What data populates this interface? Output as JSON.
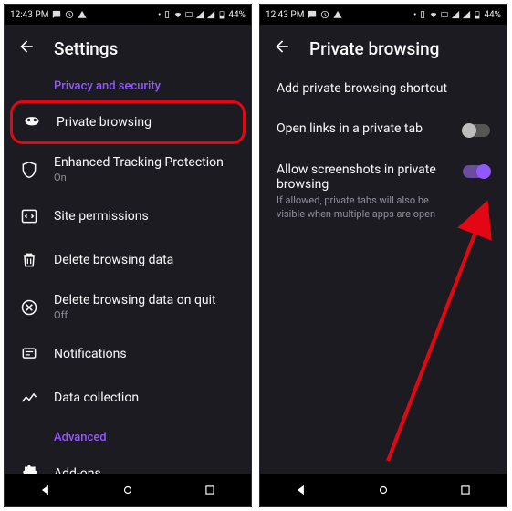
{
  "statusbar": {
    "time": "12:43 PM",
    "battery": "44%"
  },
  "left_screen": {
    "title": "Settings",
    "sections": {
      "privacy_header": "Privacy and security",
      "private_browsing": "Private browsing",
      "etp": {
        "label": "Enhanced Tracking Protection",
        "sub": "On"
      },
      "site_permissions": "Site permissions",
      "delete_data": "Delete browsing data",
      "delete_on_quit": {
        "label": "Delete browsing data on quit",
        "sub": "Off"
      },
      "notifications": "Notifications",
      "data_collection": "Data collection",
      "advanced_header": "Advanced",
      "addons": "Add-ons"
    }
  },
  "right_screen": {
    "title": "Private browsing",
    "rows": {
      "shortcut": "Add private browsing shortcut",
      "open_links": {
        "label": "Open links in a private tab",
        "toggle": "off"
      },
      "screenshots": {
        "label": "Allow screenshots in private browsing",
        "sub": "If allowed, private tabs will also be visible when multiple apps are open",
        "toggle": "on"
      }
    }
  }
}
